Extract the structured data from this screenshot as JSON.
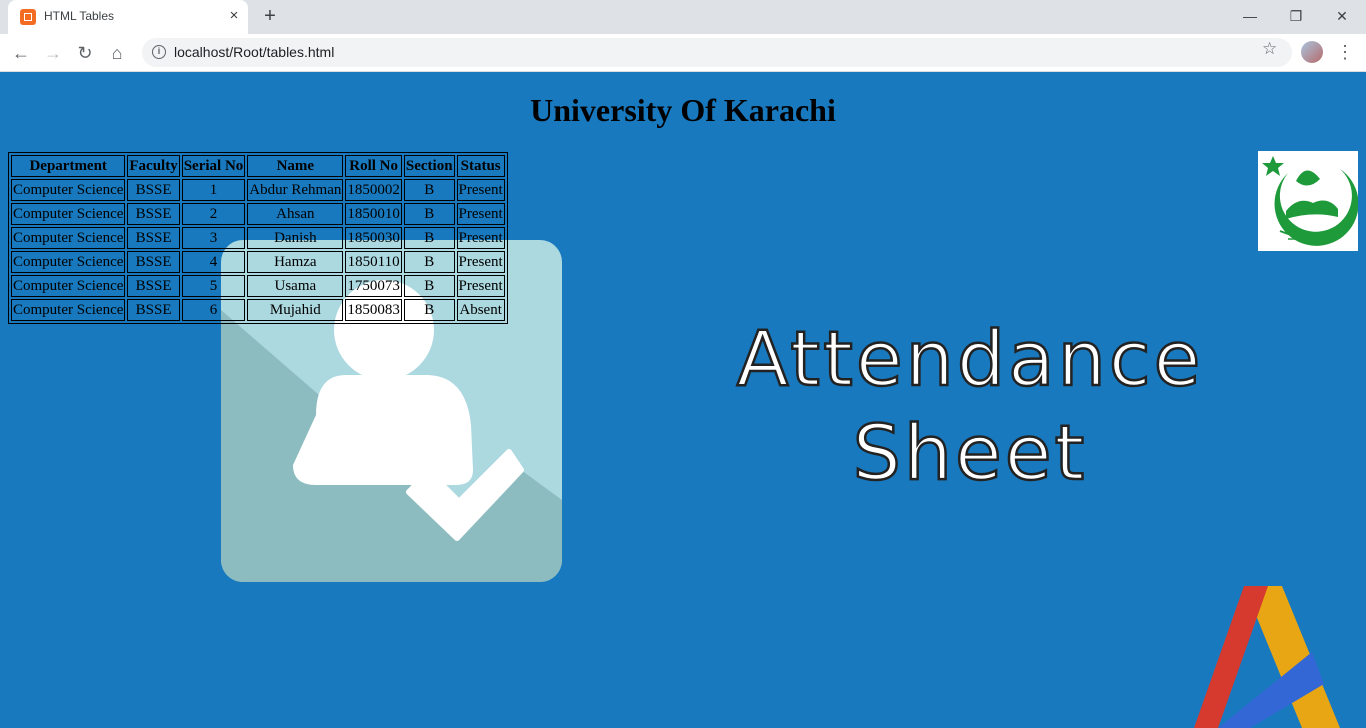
{
  "browser": {
    "tab_title": "HTML Tables",
    "tab_close": "×",
    "new_tab": "+",
    "window_minimize": "—",
    "window_restore": "❐",
    "window_close": "✕",
    "back": "←",
    "forward": "→",
    "reload": "↻",
    "home": "⌂",
    "url": "localhost/Root/tables.html",
    "bookmark_star": "☆",
    "menu": "⋮",
    "info_icon": "i"
  },
  "page": {
    "heading": "University Of Karachi",
    "attendance_line1": "Attendance",
    "attendance_line2": "Sheet",
    "background_color": "#1879be"
  },
  "table": {
    "headers": [
      "Department",
      "Faculty",
      "Serial No",
      "Name",
      "Roll No",
      "Section",
      "Status"
    ],
    "rows": [
      [
        "Computer Science",
        "BSSE",
        "1",
        "Abdur Rehman",
        "1850002",
        "B",
        "Present"
      ],
      [
        "Computer Science",
        "BSSE",
        "2",
        "Ahsan",
        "1850010",
        "B",
        "Present"
      ],
      [
        "Computer Science",
        "BSSE",
        "3",
        "Danish",
        "1850030",
        "B",
        "Present"
      ],
      [
        "Computer Science",
        "BSSE",
        "4",
        "Hamza",
        "1850110",
        "B",
        "Present"
      ],
      [
        "Computer Science",
        "BSSE",
        "5",
        "Usama",
        "1750073",
        "B",
        "Present"
      ],
      [
        "Computer Science",
        "BSSE",
        "6",
        "Mujahid",
        "1850083",
        "B",
        "Absent"
      ]
    ]
  }
}
